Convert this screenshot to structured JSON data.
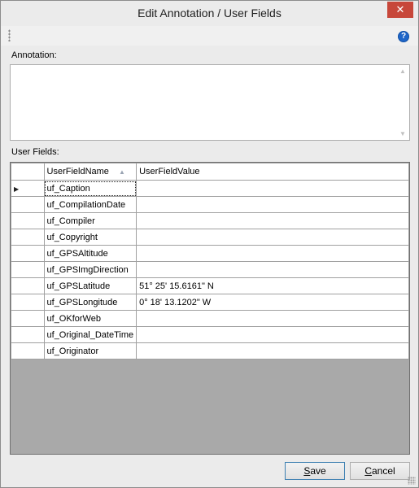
{
  "window": {
    "title": "Edit Annotation / User Fields",
    "close_glyph": "✕"
  },
  "toolbar": {
    "help_glyph": "?"
  },
  "annotation": {
    "label": "Annotation:",
    "value": ""
  },
  "user_fields": {
    "label": "User Fields:",
    "columns": [
      "UserFieldName",
      "UserFieldValue"
    ],
    "sort_glyph": "▲",
    "current_row_glyph": "▶",
    "rows": [
      {
        "name": "uf_Caption",
        "value": ""
      },
      {
        "name": "uf_CompilationDate",
        "value": ""
      },
      {
        "name": "uf_Compiler",
        "value": ""
      },
      {
        "name": "uf_Copyright",
        "value": ""
      },
      {
        "name": "uf_GPSAltitude",
        "value": ""
      },
      {
        "name": "uf_GPSImgDirection",
        "value": ""
      },
      {
        "name": "uf_GPSLatitude",
        "value": "51° 25' 15.6161\" N"
      },
      {
        "name": "uf_GPSLongitude",
        "value": "0° 18' 13.1202\" W"
      },
      {
        "name": "uf_OKforWeb",
        "value": ""
      },
      {
        "name": "uf_Original_DateTime",
        "value": ""
      },
      {
        "name": "uf_Originator",
        "value": ""
      }
    ]
  },
  "buttons": {
    "save_label": "Save",
    "cancel_label": "Cancel"
  },
  "icons": {
    "close": "close-icon",
    "help": "help-icon",
    "grip": "grip-icon",
    "sort": "sort-ascending-icon",
    "current_row": "current-row-icon"
  }
}
